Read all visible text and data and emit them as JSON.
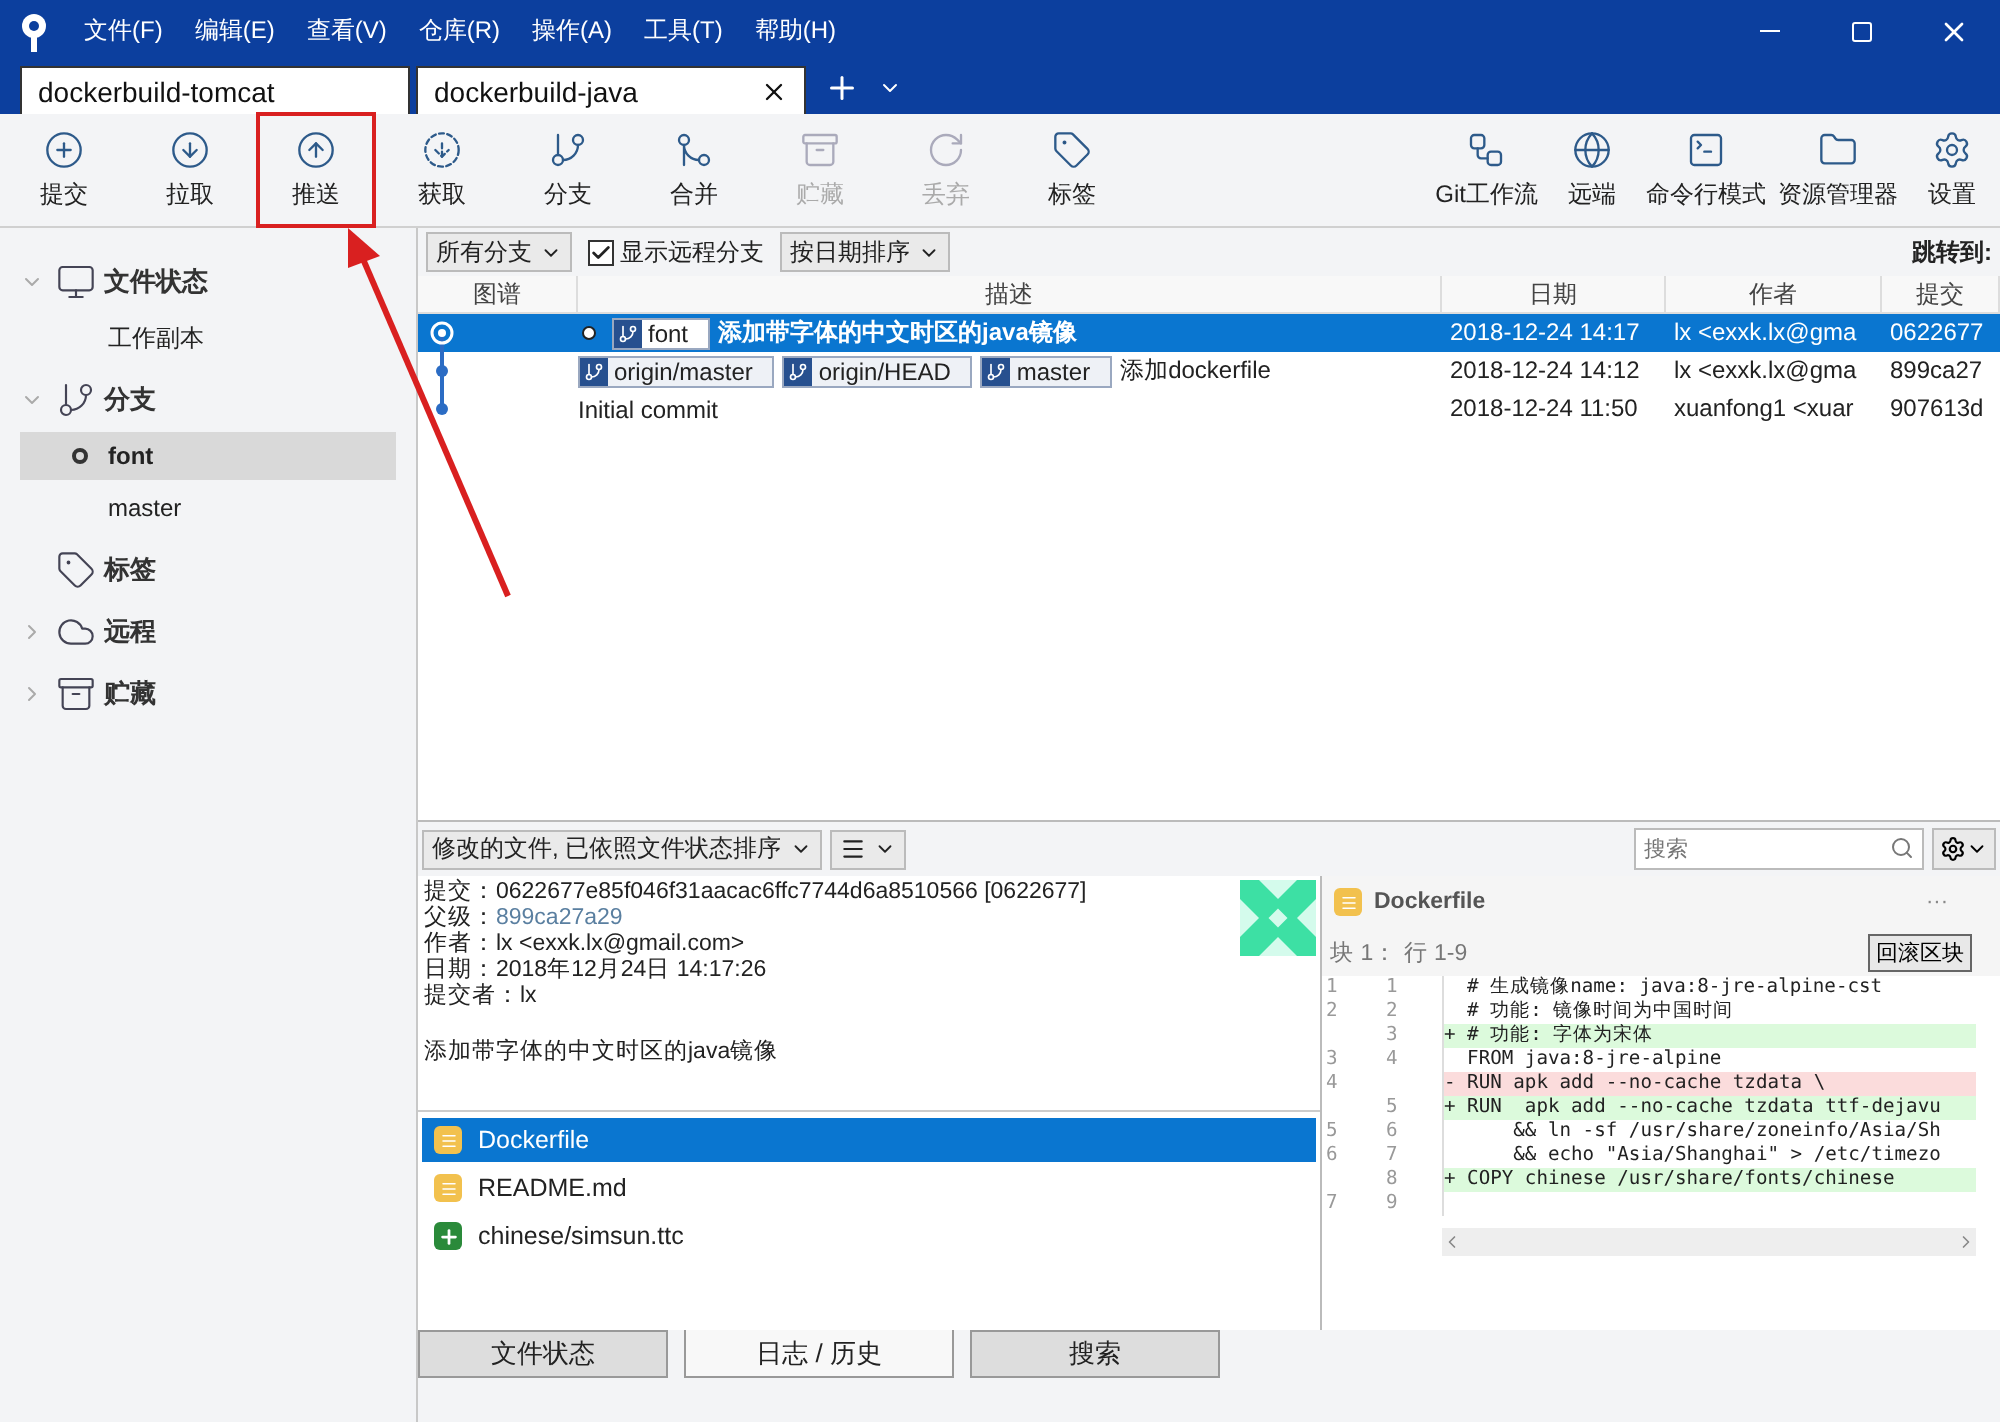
{
  "menu": [
    "文件(F)",
    "编辑(E)",
    "查看(V)",
    "仓库(R)",
    "操作(A)",
    "工具(T)",
    "帮助(H)"
  ],
  "tabs": [
    {
      "label": "dockerbuild-tomcat",
      "selected": false
    },
    {
      "label": "dockerbuild-java",
      "selected": true
    }
  ],
  "toolbar": [
    {
      "kind": "commit",
      "label": "提交",
      "disabled": false,
      "highlighted": false
    },
    {
      "kind": "pull",
      "label": "拉取",
      "disabled": false,
      "highlighted": false
    },
    {
      "kind": "push",
      "label": "推送",
      "disabled": false,
      "highlighted": true
    },
    {
      "kind": "fetch",
      "label": "获取",
      "disabled": false,
      "highlighted": false
    },
    {
      "kind": "branch",
      "label": "分支",
      "disabled": false,
      "highlighted": false
    },
    {
      "kind": "merge",
      "label": "合并",
      "disabled": false,
      "highlighted": false
    },
    {
      "kind": "stash",
      "label": "贮藏",
      "disabled": true,
      "highlighted": false
    },
    {
      "kind": "discard",
      "label": "丢弃",
      "disabled": true,
      "highlighted": false
    },
    {
      "kind": "tag",
      "label": "标签",
      "disabled": false,
      "highlighted": false
    }
  ],
  "toolbar_right": [
    {
      "kind": "flow",
      "label": "Git工作流"
    },
    {
      "kind": "remote",
      "label": "远端"
    },
    {
      "kind": "terminal",
      "label": "命令行模式"
    },
    {
      "kind": "explorer",
      "label": "资源管理器"
    },
    {
      "kind": "settings",
      "label": "设置"
    }
  ],
  "sidebar": [
    {
      "kind": "status",
      "label": "文件状态",
      "expanded": true,
      "children": [
        {
          "label": "工作副本",
          "selected": false,
          "current": false
        }
      ]
    },
    {
      "kind": "branch",
      "label": "分支",
      "expanded": true,
      "children": [
        {
          "label": "font",
          "selected": true,
          "current": true
        },
        {
          "label": "master",
          "selected": false,
          "current": false
        }
      ]
    },
    {
      "kind": "tag",
      "label": "标签"
    },
    {
      "kind": "remote",
      "label": "远程",
      "expanded": false
    },
    {
      "kind": "stash",
      "label": "贮藏",
      "expanded": false
    }
  ],
  "filters": {
    "branches": "所有分支",
    "show_remote": {
      "label": "显示远程分支",
      "checked": true
    },
    "sort": "按日期排序",
    "jump_to": "跳转到:"
  },
  "columns": [
    "图谱",
    "描述",
    "日期",
    "作者",
    "提交"
  ],
  "commits": [
    {
      "selected": true,
      "head": true,
      "tags": [
        "font"
      ],
      "description": "添加带字体的中文时区的java镜像",
      "date": "2018-12-24 14:17",
      "author": "lx <exxk.lx@gma",
      "commit": "0622677"
    },
    {
      "selected": false,
      "head": false,
      "tags": [
        "origin/master",
        "origin/HEAD",
        "master"
      ],
      "description": "添加dockerfile",
      "date": "2018-12-24 14:12",
      "author": "lx <exxk.lx@gma",
      "commit": "899ca27"
    },
    {
      "selected": false,
      "head": false,
      "description": "Initial commit",
      "date": "2018-12-24 11:50",
      "author": "xuanfong1 <xuar",
      "commit": "907613d"
    }
  ],
  "file_sort": "修改的文件, 已依照文件状态排序",
  "search": {
    "placeholder": "搜索"
  },
  "details": [
    {
      "label": "提交：",
      "value": "0622677e85f046f31aacac6ffc7744d6a8510566 [0622677]",
      "kind": "text"
    },
    {
      "label": "父级：",
      "value": "899ca27a29",
      "kind": "link"
    },
    {
      "label": "作者：",
      "value": "lx <exxk.lx@gmail.com>",
      "kind": "text"
    },
    {
      "label": "日期：",
      "value": "2018年12月24日 14:17:26",
      "kind": "text"
    },
    {
      "label": "提交者：",
      "value": "lx",
      "kind": "text"
    }
  ],
  "message": "添加带字体的中文时区的java镜像",
  "files": [
    {
      "name": "Dockerfile",
      "kind": "modified",
      "selected": true
    },
    {
      "name": "README.md",
      "kind": "modified",
      "selected": false
    },
    {
      "name": "chinese/simsun.ttc",
      "kind": "added",
      "selected": false
    }
  ],
  "diff": {
    "file": "Dockerfile",
    "more": "···",
    "hunk": "块 1： 行 1-9",
    "revert": "回滚区块",
    "lines": [
      {
        "old": "1",
        "new": "1",
        "kind": "context",
        "text": "  # 生成镜像name: java:8-jre-alpine-cst"
      },
      {
        "old": "2",
        "new": "2",
        "kind": "context",
        "text": "  # 功能: 镜像时间为中国时间"
      },
      {
        "new": "3",
        "kind": "add",
        "text": "+ # 功能: 字体为宋体"
      },
      {
        "old": "3",
        "new": "4",
        "kind": "context",
        "text": "  FROM java:8-jre-alpine"
      },
      {
        "old": "4",
        "kind": "remove",
        "text": "- RUN apk add --no-cache tzdata \\"
      },
      {
        "new": "5",
        "kind": "add",
        "text": "+ RUN  apk add --no-cache tzdata ttf-dejavu"
      },
      {
        "old": "5",
        "new": "6",
        "kind": "context",
        "text": "      && ln -sf /usr/share/zoneinfo/Asia/Sh"
      },
      {
        "old": "6",
        "new": "7",
        "kind": "context",
        "text": "      && echo \"Asia/Shanghai\" > /etc/timezo"
      },
      {
        "new": "8",
        "kind": "add",
        "text": "+ COPY chinese /usr/share/fonts/chinese"
      },
      {
        "old": "7",
        "new": "9",
        "kind": "context"
      }
    ]
  },
  "bottom_tabs": [
    {
      "label": "文件状态",
      "selected": false
    },
    {
      "label": "日志 / 历史",
      "selected": true
    },
    {
      "label": "搜索",
      "selected": false
    }
  ]
}
